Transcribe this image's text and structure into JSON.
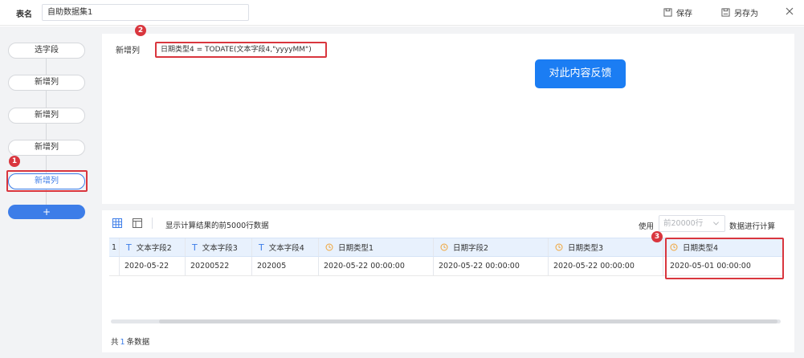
{
  "header": {
    "name_label": "表名",
    "name_value": "自助数据集1",
    "save_label": "保存",
    "save_as_label": "另存为"
  },
  "sidebar": {
    "steps": [
      {
        "label": "选字段"
      },
      {
        "label": "新增列"
      },
      {
        "label": "新增列"
      },
      {
        "label": "新增列"
      },
      {
        "label": "新增列",
        "active": true
      }
    ],
    "add_label": "+"
  },
  "formula": {
    "label": "新增列",
    "expression": "日期类型4 = TODATE(文本字段4,\"yyyyMM\")"
  },
  "feedback_label": "对此内容反馈",
  "preview": {
    "info_text": "显示计算结果的前5000行数据",
    "use_label": "使用",
    "use_placeholder": "前20000行",
    "use_suffix": "数据进行计算"
  },
  "table": {
    "columns": [
      {
        "name": "1",
        "type": "none"
      },
      {
        "name": "文本字段2",
        "type": "text"
      },
      {
        "name": "文本字段3",
        "type": "text"
      },
      {
        "name": "文本字段4",
        "type": "text"
      },
      {
        "name": "日期类型1",
        "type": "date"
      },
      {
        "name": "日期字段2",
        "type": "date"
      },
      {
        "name": "日期类型3",
        "type": "date"
      },
      {
        "name": "日期类型4",
        "type": "date"
      }
    ],
    "row": [
      "",
      "2020-05-22",
      "20200522",
      "202005",
      "2020-05-22 00:00:00",
      "2020-05-22 00:00:00",
      "2020-05-22 00:00:00",
      "2020-05-01 00:00:00"
    ]
  },
  "footer": {
    "prefix": "共",
    "count": "1",
    "suffix": "条数据"
  },
  "badges": [
    "1",
    "2",
    "3"
  ],
  "colors": {
    "primary": "#3d7de8",
    "highlight": "#d9363e",
    "header_bg": "#e8f1fd",
    "feedback_bg": "#1b7df3"
  },
  "icons": [
    "save-icon",
    "save-as-icon",
    "close-icon",
    "grid-view-icon",
    "panel-view-icon",
    "chevron-down-icon",
    "text-type-icon",
    "clock-icon"
  ]
}
